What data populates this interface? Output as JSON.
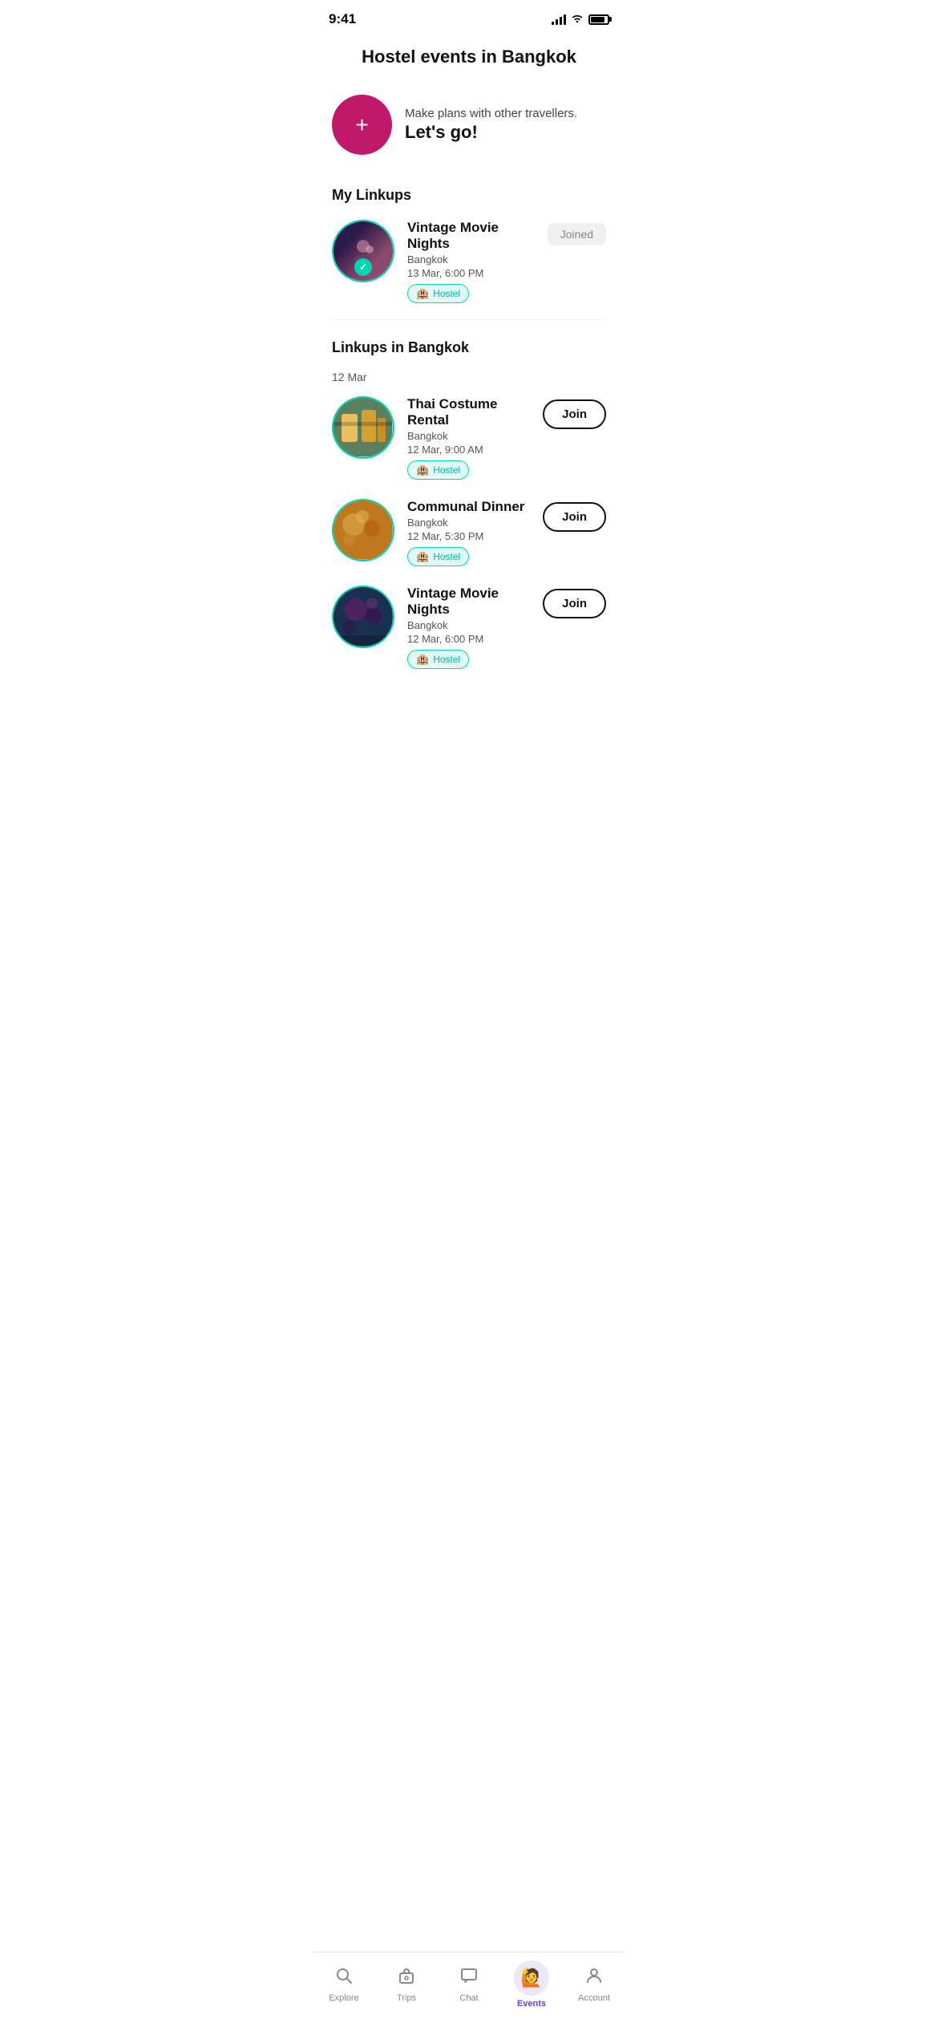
{
  "statusBar": {
    "time": "9:41"
  },
  "pageTitle": "Hostel events in Bangkok",
  "createBanner": {
    "subtitle": "Make plans with other travellers.",
    "title": "Let's go!",
    "plusLabel": "+"
  },
  "myLinkupsSection": {
    "header": "My Linkups",
    "events": [
      {
        "id": "vintage-movie-1",
        "name": "Vintage Movie Nights",
        "location": "Bangkok",
        "datetime": "13 Mar, 6:00 PM",
        "badge": "Hostel",
        "action": "Joined",
        "hasCheckmark": true
      }
    ]
  },
  "linkupsBangkokSection": {
    "header": "Linkups in Bangkok",
    "dateGroups": [
      {
        "date": "12 Mar",
        "events": [
          {
            "id": "thai-costume",
            "name": "Thai Costume Rental",
            "location": "Bangkok",
            "datetime": "12 Mar, 9:00 AM",
            "badge": "Hostel",
            "action": "Join"
          },
          {
            "id": "communal-dinner",
            "name": "Communal Dinner",
            "location": "Bangkok",
            "datetime": "12 Mar, 5:30 PM",
            "badge": "Hostel",
            "action": "Join"
          },
          {
            "id": "vintage-movie-2",
            "name": "Vintage Movie Nights",
            "location": "Bangkok",
            "datetime": "12 Mar, 6:00 PM",
            "badge": "Hostel",
            "action": "Join"
          }
        ]
      }
    ]
  },
  "bottomNav": {
    "items": [
      {
        "id": "explore",
        "label": "Explore",
        "icon": "search"
      },
      {
        "id": "trips",
        "label": "Trips",
        "icon": "bag"
      },
      {
        "id": "chat",
        "label": "Chat",
        "icon": "chat"
      },
      {
        "id": "events",
        "label": "Events",
        "icon": "events",
        "active": true
      },
      {
        "id": "account",
        "label": "Account",
        "icon": "person"
      }
    ]
  }
}
